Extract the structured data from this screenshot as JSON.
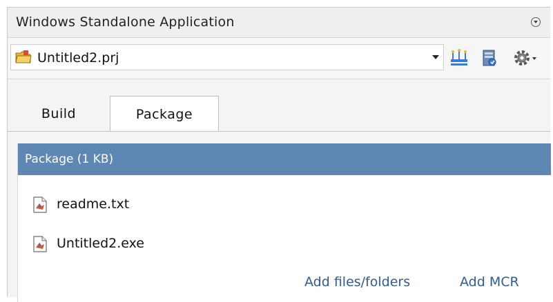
{
  "window": {
    "title": "Windows Standalone Application"
  },
  "project": {
    "name": "Untitled2.prj"
  },
  "toolbar": {
    "icons": [
      "folder-icon",
      "chevron-down-icon",
      "package-icon",
      "mcr-icon",
      "gear-icon"
    ]
  },
  "tabs": [
    {
      "label": "Build",
      "active": false
    },
    {
      "label": "Package",
      "active": true
    }
  ],
  "package": {
    "header": "Package (1 KB)",
    "files": [
      {
        "name": "readme.txt"
      },
      {
        "name": "Untitled2.exe"
      }
    ],
    "add_files_label": "Add files/folders",
    "add_mcr_label": "Add MCR"
  },
  "colors": {
    "header_bg": "#5f87b3",
    "link": "#2e5c92"
  }
}
